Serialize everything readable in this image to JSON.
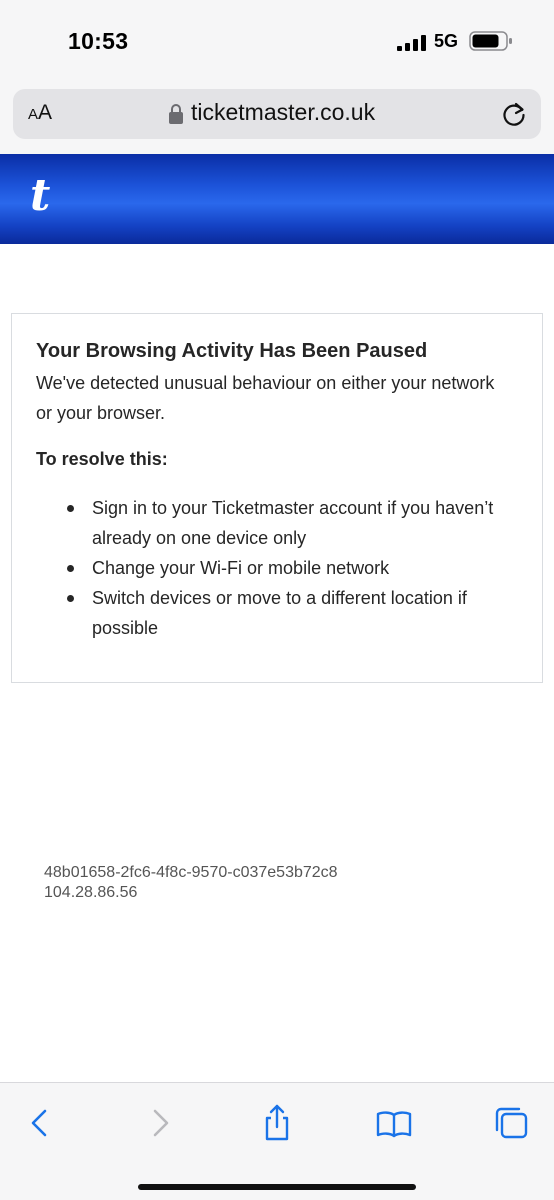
{
  "status_bar": {
    "time": "10:53",
    "network": "5G",
    "signal_icon": "cellular-signal-icon",
    "battery_icon": "battery-icon"
  },
  "browser": {
    "text_size_label": "AA",
    "url": "ticketmaster.co.uk",
    "lock_icon": "lock-icon",
    "reload_icon": "reload-icon"
  },
  "header": {
    "logo_text": "t",
    "brand_color": "#1f5ae0"
  },
  "message": {
    "title": "Your Browsing Activity Has Been Paused",
    "description": "We've detected unusual behaviour on either your network or your browser.",
    "resolve_heading": "To resolve this:",
    "steps": [
      "Sign in to your Ticketmaster account if you haven’t already on one device only",
      "Change your Wi-Fi or mobile network",
      "Switch devices or move to a different location if possible"
    ]
  },
  "reference": {
    "request_id": "48b01658-2fc6-4f8c-9570-c037e53b72c8",
    "ip_address": "104.28.86.56"
  },
  "toolbar": {
    "icons": [
      "back-icon",
      "forward-icon",
      "share-icon",
      "bookmarks-icon",
      "tabs-icon"
    ],
    "accent_color": "#1a73e8"
  }
}
